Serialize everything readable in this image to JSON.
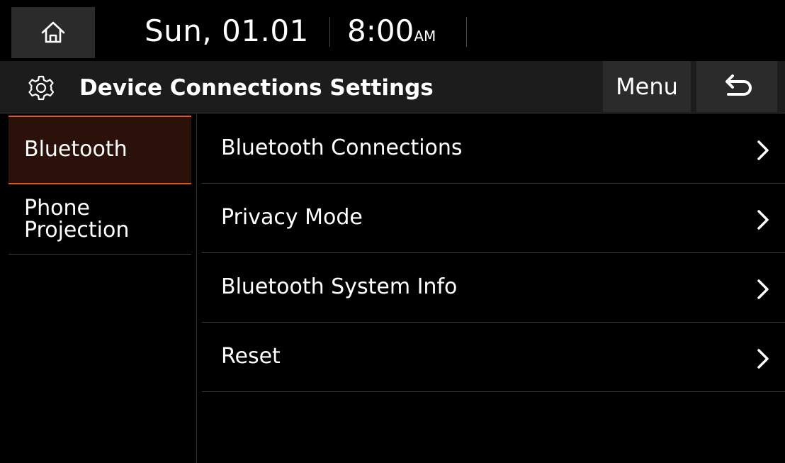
{
  "status_bar": {
    "home_icon": "home-icon",
    "date": "Sun, 01.01",
    "time": "8:00",
    "ampm": "AM"
  },
  "title_bar": {
    "icon": "gear-icon",
    "title": "Device Connections Settings",
    "menu_label": "Menu",
    "back_icon": "back-arrow-icon"
  },
  "left_nav": {
    "items": [
      {
        "label": "Bluetooth",
        "selected": true
      },
      {
        "label": "Phone Projection",
        "selected": false
      }
    ],
    "accent_color": "#e2531a"
  },
  "list": {
    "items": [
      {
        "label": "Bluetooth Connections",
        "icon": "chevron-right-icon"
      },
      {
        "label": "Privacy Mode",
        "icon": "chevron-right-icon"
      },
      {
        "label": "Bluetooth System Info",
        "icon": "chevron-right-icon"
      },
      {
        "label": "Reset",
        "icon": "chevron-right-icon"
      }
    ]
  }
}
